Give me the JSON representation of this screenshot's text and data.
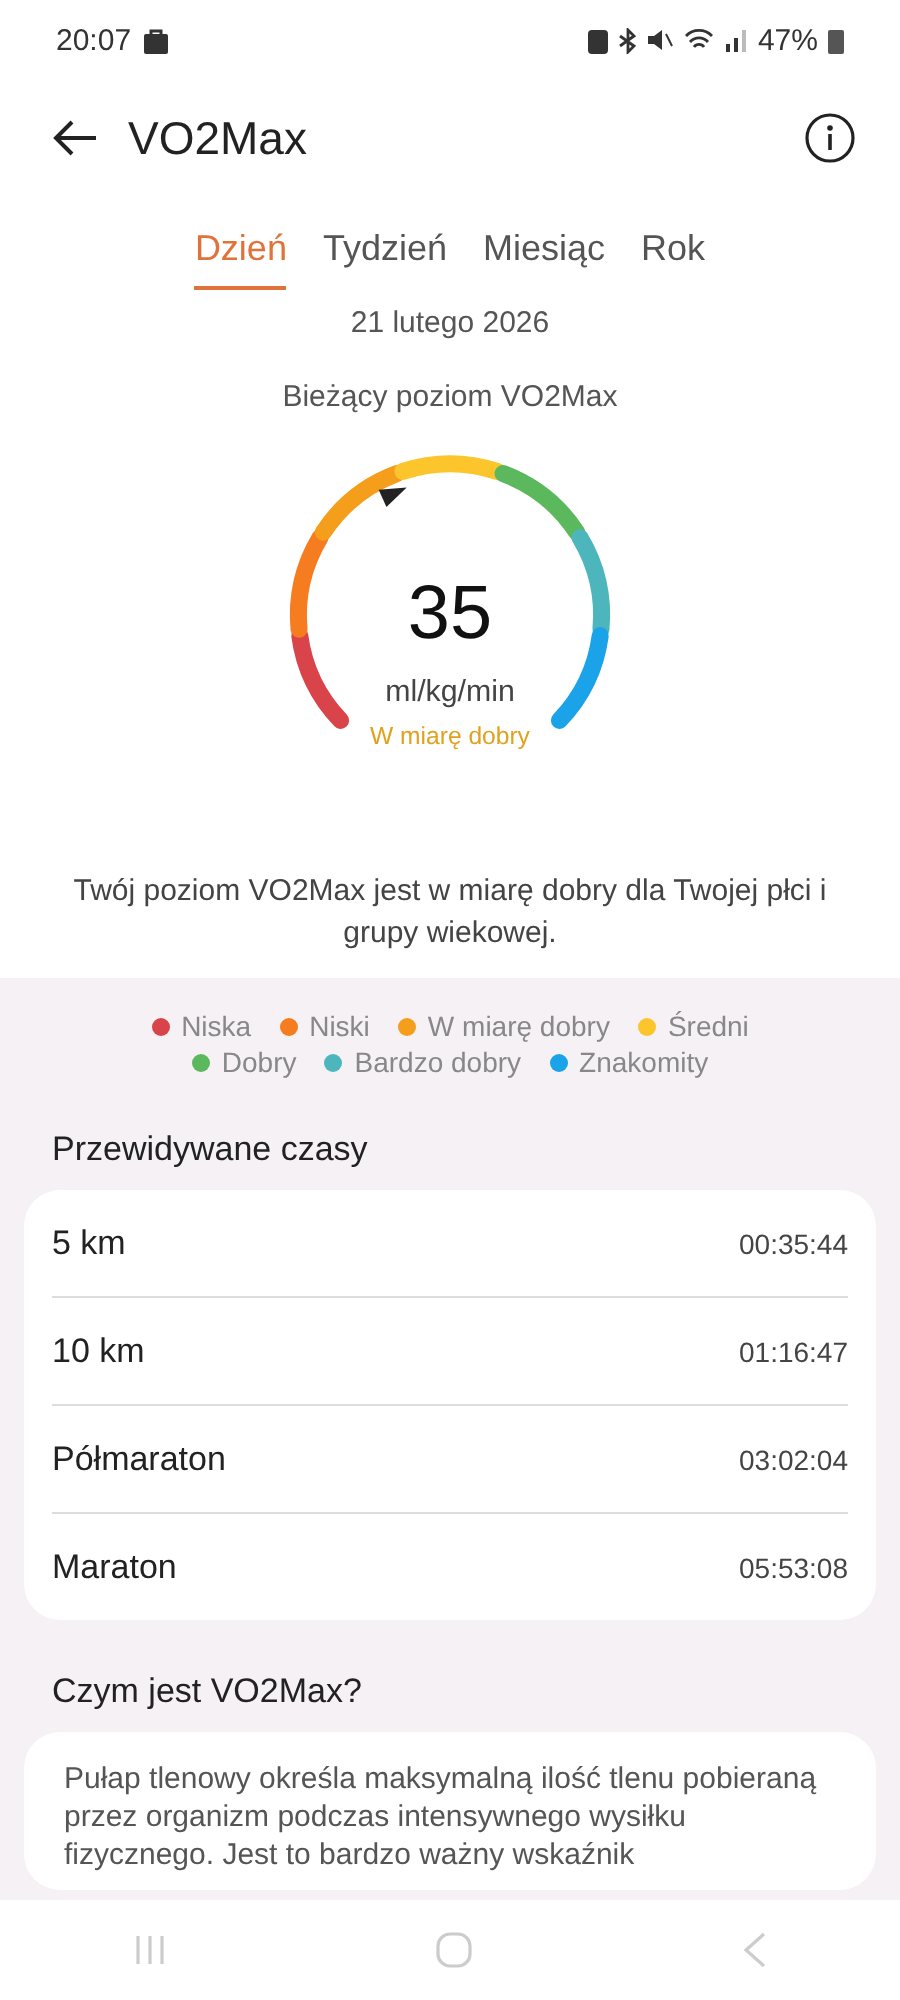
{
  "status_bar": {
    "time": "20:07",
    "battery": "47%"
  },
  "header": {
    "title": "VO2Max"
  },
  "tabs": [
    {
      "label": "Dzień",
      "selected": true
    },
    {
      "label": "Tydzień",
      "selected": false
    },
    {
      "label": "Miesiąc",
      "selected": false
    },
    {
      "label": "Rok",
      "selected": false
    }
  ],
  "date": "21 lutego 2026",
  "gauge": {
    "title": "Bieżący poziom VO2Max",
    "value": "35",
    "unit": "ml/kg/min",
    "rating": "W miarę dobry"
  },
  "description": "Twój poziom VO2Max jest w miarę dobry dla Twojej płci i grupy wiekowej.",
  "legend": [
    {
      "label": "Niska",
      "color": "#d9434a"
    },
    {
      "label": "Niski",
      "color": "#f57c1f"
    },
    {
      "label": "W miarę dobry",
      "color": "#f59e1b"
    },
    {
      "label": "Średni",
      "color": "#fcc52c"
    },
    {
      "label": "Dobry",
      "color": "#5cb85c"
    },
    {
      "label": "Bardzo dobry",
      "color": "#4db6bc"
    },
    {
      "label": "Znakomity",
      "color": "#1aa3e8"
    }
  ],
  "predicted": {
    "title": "Przewidywane czasy",
    "rows": [
      {
        "distance": "5 km",
        "time": "00:35:44"
      },
      {
        "distance": "10 km",
        "time": "01:16:47"
      },
      {
        "distance": "Półmaraton",
        "time": "03:02:04"
      },
      {
        "distance": "Maraton",
        "time": "05:53:08"
      }
    ]
  },
  "about": {
    "title": "Czym jest VO2Max?",
    "text": "Pułap tlenowy określa maksymalną ilość tlenu pobieraną przez organizm podczas intensywnego wysiłku fizycznego. Jest to bardzo ważny wskaźnik"
  }
}
